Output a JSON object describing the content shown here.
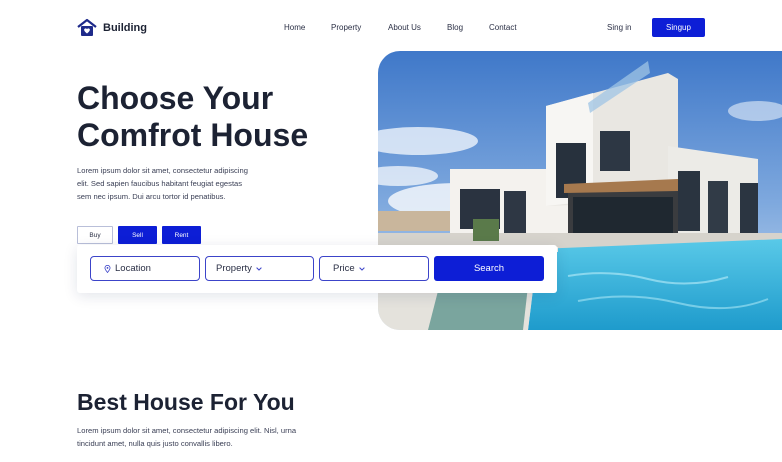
{
  "brand": {
    "name": "Building"
  },
  "nav": {
    "items": [
      "Home",
      "Property",
      "About Us",
      "Blog",
      "Contact"
    ],
    "signin": "Sing in",
    "signup": "Singup"
  },
  "hero": {
    "title_line1": "Choose Your",
    "title_line2": "Comfrot House",
    "desc_line1": "Lorem ipsum dolor sit amet, consectetur adipiscing",
    "desc_line2": "elit. Sed sapien faucibus habitant feugiat egestas",
    "desc_line3": "sem nec ipsum. Dui arcu tortor id penatibus."
  },
  "tabs": {
    "buy": "Buy",
    "sell": "Sell",
    "rent": "Rent"
  },
  "search": {
    "location": "Location",
    "property": "Property",
    "price": "Price",
    "button": "Search"
  },
  "section": {
    "title": "Best House For You",
    "desc_line1": "Lorem ipsum dolor sit amet, consectetur adipiscing elit. Nisl, urna",
    "desc_line2": "tincidunt amet, nulla quis justo convallis libero."
  },
  "colors": {
    "accent": "#0d1ed6",
    "heading": "#1c2233"
  },
  "icons": {
    "logo": "house-heart-icon",
    "location": "map-pin-icon",
    "dropdown": "chevron-down-icon"
  }
}
